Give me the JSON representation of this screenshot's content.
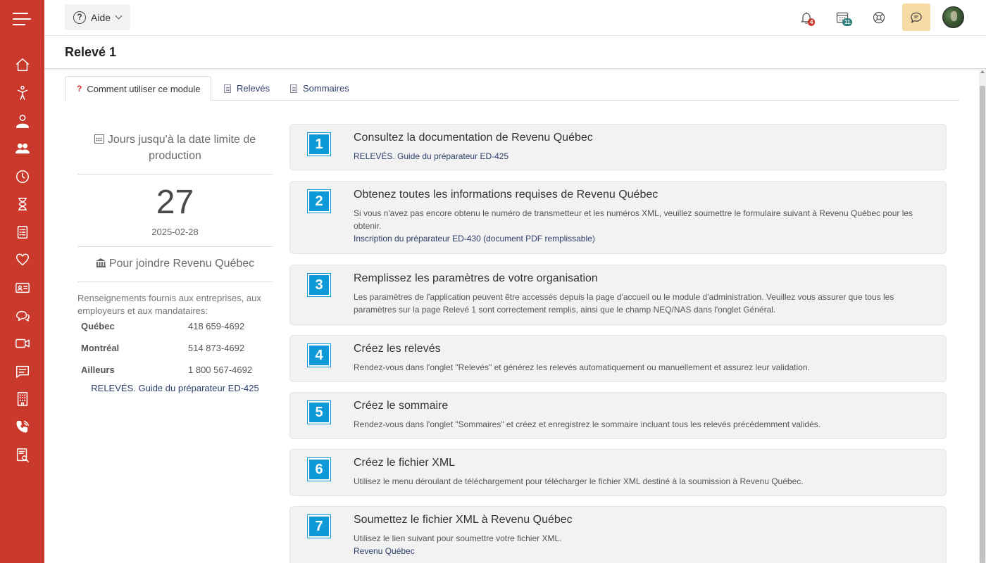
{
  "topbar": {
    "help_label": "Aide",
    "notif_count": "4",
    "calendar_count": "11"
  },
  "page": {
    "title": "Relevé 1"
  },
  "tabs": [
    {
      "label": "Comment utiliser ce module",
      "icon": "question-icon",
      "active": true
    },
    {
      "label": "Relevés",
      "icon": "document-icon",
      "active": false
    },
    {
      "label": "Sommaires",
      "icon": "document-icon",
      "active": false
    }
  ],
  "deadline": {
    "heading": "Jours jusqu'à la date limite de production",
    "days": "27",
    "date": "2025-02-28"
  },
  "contact": {
    "heading": "Pour joindre Revenu Québec",
    "intro": "Renseignements fournis aux entreprises, aux employeurs et aux mandataires:",
    "rows": [
      {
        "city": "Québec",
        "phone": "418 659-4692"
      },
      {
        "city": "Montréal",
        "phone": "514 873-4692"
      },
      {
        "city": "Ailleurs",
        "phone": "1 800 567-4692"
      }
    ],
    "link": "RELEVÉS. Guide du préparateur ED-425"
  },
  "steps": [
    {
      "num": "1",
      "title": "Consultez la documentation de Revenu Québec",
      "text": "",
      "link": "RELEVÉS. Guide du préparateur ED-425"
    },
    {
      "num": "2",
      "title": "Obtenez toutes les informations requises de Revenu Québec",
      "text": "Si vous n'avez pas encore obtenu le numéro de transmetteur et les numéros XML, veuillez soumettre le formulaire suivant à Revenu Québec pour les obtenir.",
      "link": "Inscription du préparateur ED-430 (document PDF remplissable)"
    },
    {
      "num": "3",
      "title": "Remplissez les paramètres de votre organisation",
      "text": "Les paramètres de l'application peuvent être accessés depuis la page d'accueil ou le module d'administration. Veuillez vous assurer que tous les paramètres sur la page Relevé 1 sont correctement remplis, ainsi que le champ NEQ/NAS dans l'onglet Général.",
      "link": ""
    },
    {
      "num": "4",
      "title": "Créez les relevés",
      "text": "Rendez-vous dans l'onglet \"Relevés\" et générez les relevés automatiquement ou manuellement et assurez leur validation.",
      "link": ""
    },
    {
      "num": "5",
      "title": "Créez le sommaire",
      "text": "Rendez-vous dans l'onglet \"Sommaires\" et créez et enregistrez le sommaire incluant tous les relevés précédemment validés.",
      "link": ""
    },
    {
      "num": "6",
      "title": "Créez le fichier XML",
      "text": "Utilisez le menu déroulant de téléchargement pour télécharger le fichier XML destiné à la soumission à Revenu Québec.",
      "link": ""
    },
    {
      "num": "7",
      "title": "Soumettez le fichier XML à Revenu Québec",
      "text": "Utilisez le lien suivant pour soumettre votre fichier XML.",
      "link": "Revenu Québec"
    }
  ],
  "colors": {
    "sidebar": "#c9392c",
    "step_badge": "#0e9ad8",
    "link": "#2d3e6b",
    "chat_button": "#f7dba5"
  }
}
